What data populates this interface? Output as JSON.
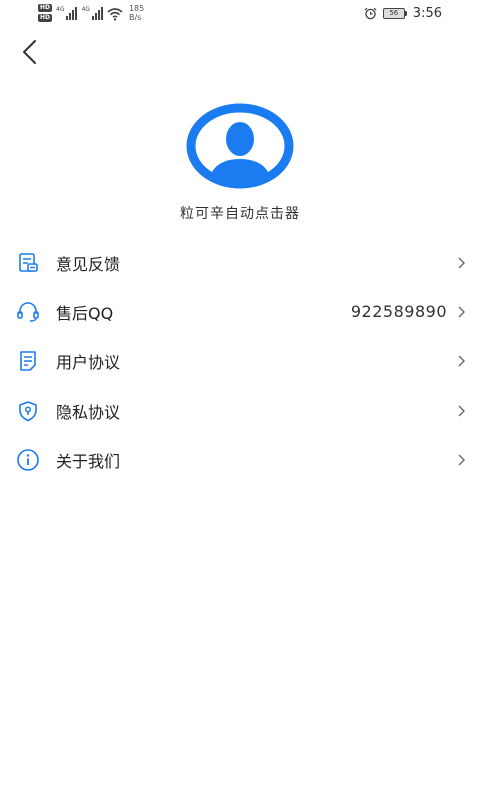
{
  "status_bar": {
    "hd1": "HD",
    "hd2": "HD",
    "net1": "4G",
    "net2": "4G",
    "speed_value": "185",
    "speed_unit": "B/s",
    "battery": "56",
    "time": "3:56"
  },
  "header": {
    "back_icon": "chevron-left-icon"
  },
  "profile": {
    "avatar_icon": "user-avatar-icon",
    "app_name": "粒可辛自动点击器"
  },
  "menu": {
    "items": [
      {
        "icon": "feedback-icon",
        "label": "意见反馈",
        "value": ""
      },
      {
        "icon": "headset-icon",
        "label": "售后QQ",
        "value": "922589890"
      },
      {
        "icon": "document-icon",
        "label": "用户协议",
        "value": ""
      },
      {
        "icon": "shield-icon",
        "label": "隐私协议",
        "value": ""
      },
      {
        "icon": "info-icon",
        "label": "关于我们",
        "value": ""
      }
    ]
  },
  "colors": {
    "accent": "#1a7cf0",
    "text": "#222222",
    "arrow": "#666666"
  }
}
